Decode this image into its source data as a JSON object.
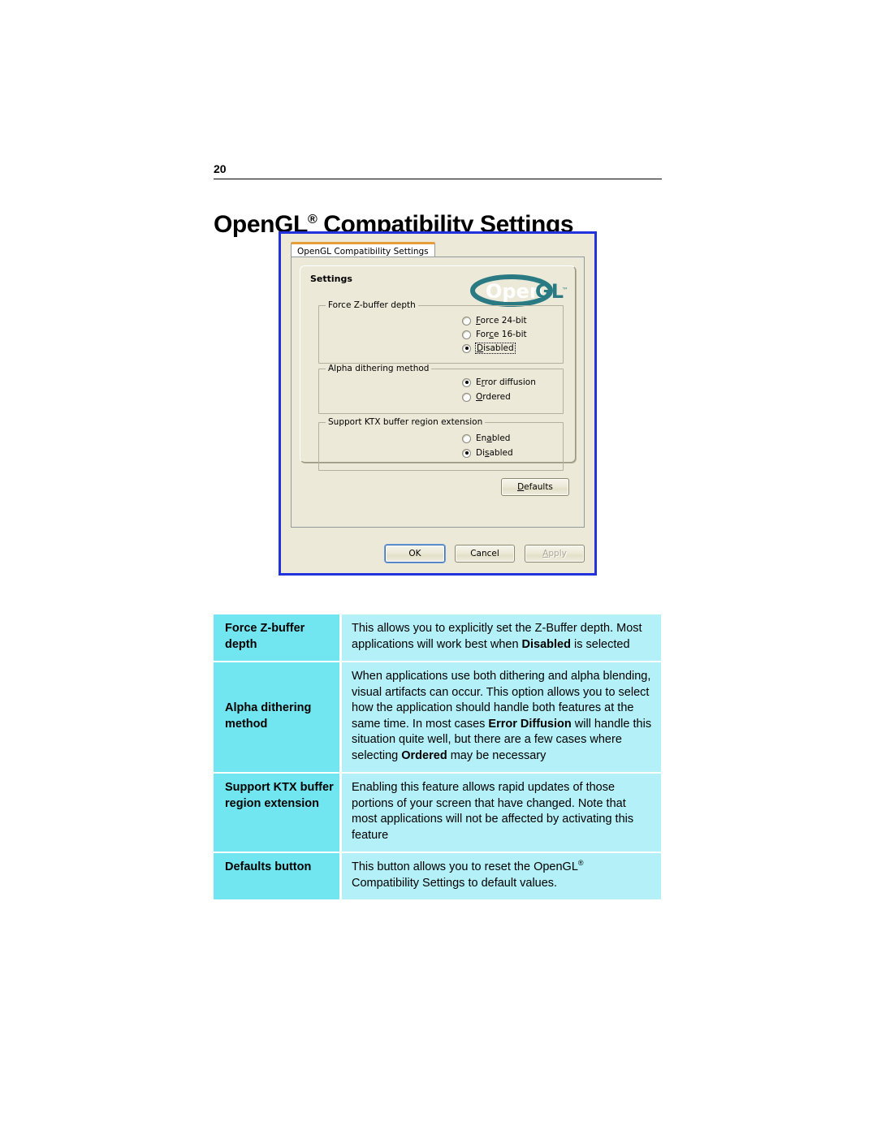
{
  "page": {
    "number": "20",
    "title_main": "OpenGL",
    "title_sup": "®",
    "title_rest": " Compatibility Settings"
  },
  "dialog": {
    "tab_label": "OpenGL Compatibility Settings",
    "panel_label": "Settings",
    "logo": {
      "open_text": "Open",
      "gl_text": "GL",
      "tm_text": "™",
      "color": "#2a7a83"
    },
    "groups": [
      {
        "name": "force-z-buffer-depth",
        "title": "Force Z-buffer depth",
        "options": [
          {
            "label_before": "",
            "accel": "F",
            "label_after": "orce 24-bit",
            "checked": false,
            "focused": false
          },
          {
            "label_before": "For",
            "accel": "c",
            "label_after": "e 16-bit",
            "checked": false,
            "focused": false
          },
          {
            "label_before": "",
            "accel": "D",
            "label_after": "isabled",
            "checked": true,
            "focused": true
          }
        ]
      },
      {
        "name": "alpha-dithering-method",
        "title": "Alpha dithering method",
        "options": [
          {
            "label_before": "E",
            "accel": "r",
            "label_after": "ror diffusion",
            "checked": true,
            "focused": false
          },
          {
            "label_before": "",
            "accel": "O",
            "label_after": "rdered",
            "checked": false,
            "focused": false
          }
        ]
      },
      {
        "name": "support-ktx-buffer-region-extension",
        "title": "Support KTX buffer region extension",
        "options": [
          {
            "label_before": "En",
            "accel": "a",
            "label_after": "bled",
            "checked": false,
            "focused": false
          },
          {
            "label_before": "Di",
            "accel": "s",
            "label_after": "abled",
            "checked": true,
            "focused": false
          }
        ]
      }
    ],
    "buttons": {
      "defaults_before": "",
      "defaults_accel": "D",
      "defaults_after": "efaults",
      "ok": "OK",
      "cancel": "Cancel",
      "apply_accel": "A",
      "apply_after": "pply",
      "apply_disabled": true
    },
    "colors": {
      "border": "#2233dd",
      "face": "#ece9d8",
      "tab_active_top": "#e79e39"
    }
  },
  "table": {
    "colors": {
      "term_bg": "#72e6f0",
      "def_bg": "#b3f0f7"
    },
    "rows": [
      {
        "term": "Force Z-buffer depth",
        "parts": [
          {
            "t": "This allows you to explicitly set the Z-Buffer depth. Most applications will work best when ",
            "b": false
          },
          {
            "t": "Disabled",
            "b": true
          },
          {
            "t": " is selected",
            "b": false
          }
        ]
      },
      {
        "term": "Alpha dithering method",
        "parts": [
          {
            "t": "When applications use both dithering and alpha blending, visual artifacts can occur. This option allows you to select how the application should handle both features at the same time. In most cases ",
            "b": false
          },
          {
            "t": "Error Diffusion",
            "b": true
          },
          {
            "t": " will handle this situation quite well, but there are a few cases where selecting ",
            "b": false
          },
          {
            "t": "Ordered",
            "b": true
          },
          {
            "t": " may be necessary",
            "b": false
          }
        ]
      },
      {
        "term": "Support KTX buffer region extension",
        "parts": [
          {
            "t": "Enabling this feature allows rapid updates of those portions of your screen that have changed. Note that most applications will not be affected by activating this feature",
            "b": false
          }
        ]
      },
      {
        "term": "Defaults button",
        "parts": [
          {
            "t": "This button allows you to reset the OpenGL",
            "b": false
          },
          {
            "t": "®",
            "b": false,
            "sup": true
          },
          {
            "t": " Compatibility Settings to default values.",
            "b": false
          }
        ]
      }
    ]
  }
}
